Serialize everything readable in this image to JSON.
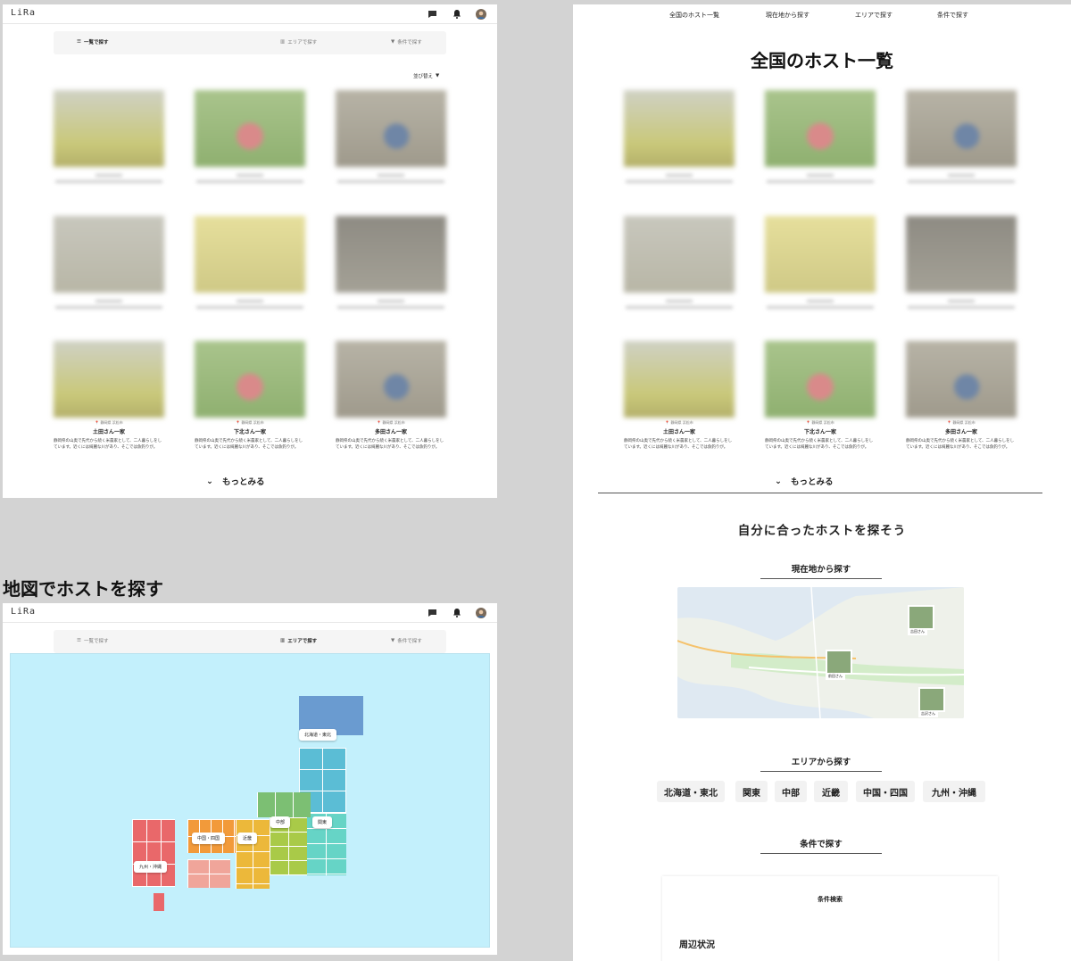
{
  "app": {
    "logo": "LiRa"
  },
  "tabs": {
    "list": "一覧で探す",
    "area": "エリアで探す",
    "conditions": "条件で探す"
  },
  "sort_label": "並び替え",
  "hosts": [
    {
      "location": "静岡県 浜松市",
      "name": "土田さん一家",
      "desc": "静岡県の山奥で先代から続く米農家として、二人暮らしをしています。近くには綺麗な川があり、そこでは魚釣りが。"
    },
    {
      "location": "静岡県 浜松市",
      "name": "下北さん一家",
      "desc": "静岡県の山奥で先代から続く米農家として、二人暮らしをしています。近くには綺麗な川があり、そこでは魚釣りが。"
    },
    {
      "location": "静岡県 浜松市",
      "name": "多田さん一家",
      "desc": "静岡県の山奥で先代から続く米農家として、二人暮らしをしています。近くには綺麗な川があり、そこでは魚釣りが。"
    }
  ],
  "more_label": "もっとみる",
  "map_section_title": "地図でホストを探す",
  "regions": {
    "hokkaido_tohoku": "北海道・東北",
    "kanto": "関東",
    "chubu": "中部",
    "kinki": "近畿",
    "chugoku_shikoku": "中国・四国",
    "kyushu_okinawa": "九州・沖縄"
  },
  "top_nav": [
    "全国のホスト一覧",
    "現在地から探す",
    "エリアで探す",
    "条件で探す"
  ],
  "page_title": "全国のホスト一覧",
  "find_title": "自分に合ったホストを探そう",
  "near_title": "現在地から探す",
  "map_pins": [
    {
      "name": "吉田さん"
    },
    {
      "name": "前田さん"
    },
    {
      "name": "吉沢さん"
    }
  ],
  "area_title": "エリアから探す",
  "area_buttons": [
    "北海道・東北",
    "関東",
    "中部",
    "近畿",
    "中国・四国",
    "九州・沖縄"
  ],
  "cond_title": "条件で探す",
  "filter": {
    "title": "条件検索",
    "surroundings": "周辺状況"
  },
  "colors": {
    "hokkaido": "#6a9bd0",
    "tohoku": "#5bbdd5",
    "kanto": "#66d4c6",
    "chubu": "#a9ca48",
    "hokuriku": "#7cbf73",
    "kinki": "#ecb83a",
    "chugoku": "#f29a3a",
    "shikoku": "#f0a59a",
    "kyushu": "#e9686a",
    "sea": "#c3f0fc"
  },
  "icons": [
    "chat-icon",
    "bell-icon",
    "avatar",
    "list-icon",
    "map-icon",
    "filter-icon",
    "chevron-down-icon",
    "caret-down-icon",
    "pin-icon"
  ]
}
